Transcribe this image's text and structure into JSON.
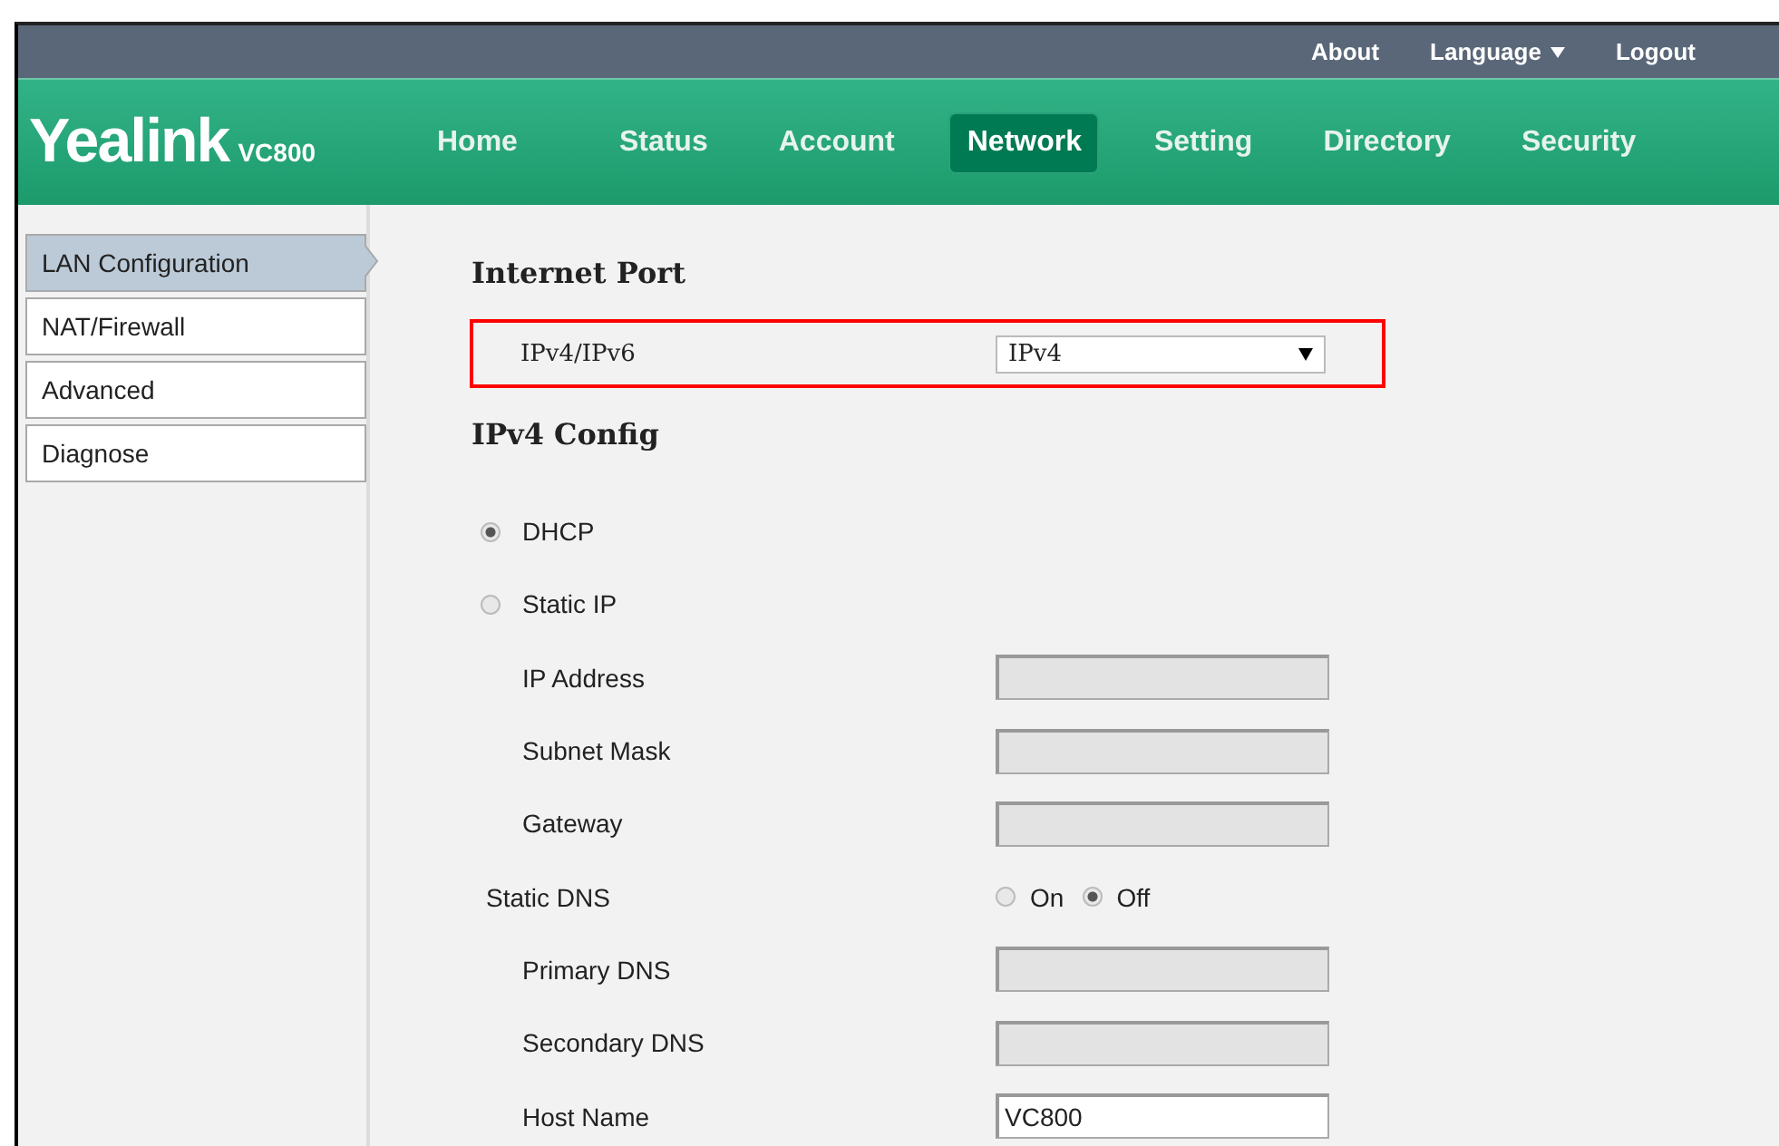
{
  "top_links": [
    {
      "label": "About",
      "has_caret": false
    },
    {
      "label": "Language",
      "has_caret": true
    },
    {
      "label": "Logout",
      "has_caret": false
    }
  ],
  "logo": {
    "brand": "Yealink",
    "model": "VC800"
  },
  "nav": [
    {
      "label": "Home",
      "selected": false
    },
    {
      "label": "Status",
      "selected": false
    },
    {
      "label": "Account",
      "selected": false
    },
    {
      "label": "Network",
      "selected": true
    },
    {
      "label": "Setting",
      "selected": false
    },
    {
      "label": "Directory",
      "selected": false
    },
    {
      "label": "Security",
      "selected": false
    }
  ],
  "sidebar": {
    "items": [
      {
        "label": "LAN Configuration",
        "selected": true
      },
      {
        "label": "NAT/Firewall",
        "selected": false
      },
      {
        "label": "Advanced",
        "selected": false
      },
      {
        "label": "Diagnose",
        "selected": false
      }
    ]
  },
  "internet_port": {
    "heading": "Internet Port",
    "label": "IPv4/IPv6",
    "value": "IPv4",
    "highlighted": true
  },
  "ipv4_config": {
    "heading": "IPv4 Config",
    "rows": [
      {
        "kind": "radio",
        "label": "DHCP",
        "selected": true
      },
      {
        "kind": "radio",
        "label": "Static IP",
        "selected": false
      },
      {
        "kind": "input",
        "label": "IP Address",
        "disabled": true
      },
      {
        "kind": "input",
        "label": "Subnet Mask",
        "disabled": true
      },
      {
        "kind": "input",
        "label": "Gateway",
        "disabled": true
      },
      {
        "kind": "toggle",
        "label": "Static DNS",
        "options": [
          {
            "label": "On",
            "selected": false
          },
          {
            "label": "Off",
            "selected": true
          }
        ]
      },
      {
        "kind": "input",
        "label": "Primary DNS",
        "disabled": true
      },
      {
        "kind": "input",
        "label": "Secondary DNS",
        "disabled": true
      },
      {
        "kind": "input",
        "label": "Host Name",
        "value": "VC800",
        "disabled": false
      }
    ]
  }
}
